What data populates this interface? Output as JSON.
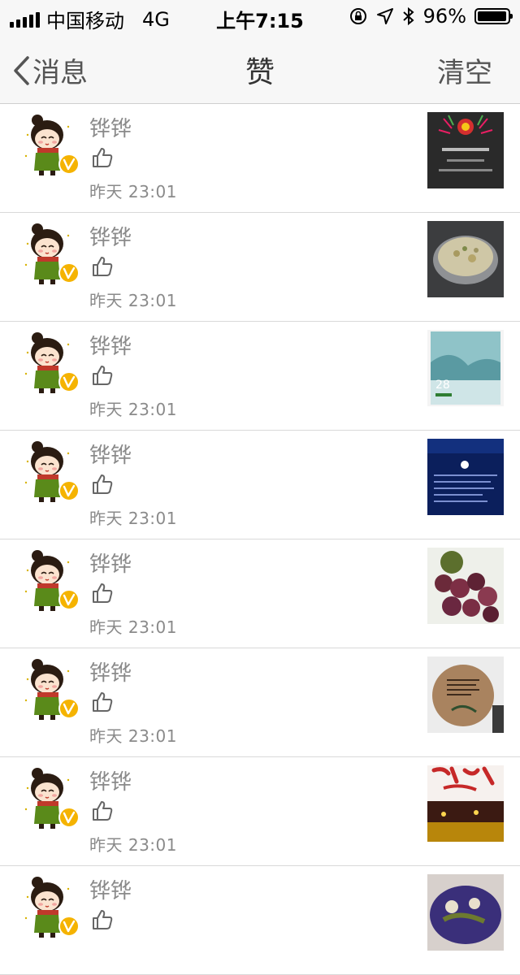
{
  "status_bar": {
    "carrier": "中国移动",
    "network": "4G",
    "time": "上午7:15",
    "battery": "96%",
    "battery_level": 0.96,
    "icons": [
      "signal-bars-icon",
      "rotation-lock-icon",
      "location-arrow-icon",
      "bluetooth-icon",
      "battery-icon"
    ]
  },
  "nav": {
    "back_label": "消息",
    "title": "赞",
    "clear_label": "清空"
  },
  "items": [
    {
      "name": "铧铧",
      "time": "昨天 23:01",
      "thumb": "award-notification-screenshot"
    },
    {
      "name": "铧铧",
      "time": "昨天 23:01",
      "thumb": "bowl-of-food-photo"
    },
    {
      "name": "铧铧",
      "time": "昨天 23:01",
      "thumb": "misty-landscape-weather-card"
    },
    {
      "name": "铧铧",
      "time": "昨天 23:01",
      "thumb": "dark-blue-info-card"
    },
    {
      "name": "铧铧",
      "time": "昨天 23:01",
      "thumb": "bayberry-fruit-photo"
    },
    {
      "name": "铧铧",
      "time": "昨天 23:01",
      "thumb": "round-wall-sign-photo"
    },
    {
      "name": "铧铧",
      "time": "昨天 23:01",
      "thumb": "red-banner-stage-photo"
    },
    {
      "name": "铧铧",
      "time": "",
      "thumb": "purple-dessert-photo"
    }
  ],
  "colors": {
    "bar_background": "#f7f7f7",
    "secondary_text": "#8a8a8a",
    "badge_yellow": "#f5b301",
    "divider": "#d9d9d9"
  }
}
